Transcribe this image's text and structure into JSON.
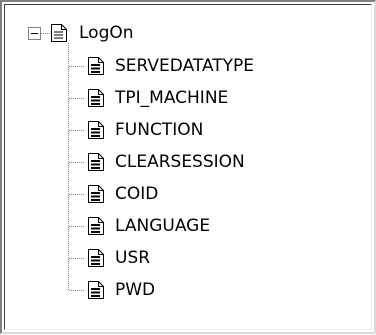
{
  "tree": {
    "root": {
      "label": "LogOn",
      "expanded": true,
      "expander_glyph": "minus-box",
      "icon": "document-icon"
    },
    "children": [
      {
        "label": "SERVEDATATYPE",
        "icon": "document-icon"
      },
      {
        "label": "TPI_MACHINE",
        "icon": "document-icon"
      },
      {
        "label": "FUNCTION",
        "icon": "document-icon"
      },
      {
        "label": "CLEARSESSION",
        "icon": "document-icon"
      },
      {
        "label": "COID",
        "icon": "document-icon"
      },
      {
        "label": "LANGUAGE",
        "icon": "document-icon"
      },
      {
        "label": "USR",
        "icon": "document-icon"
      },
      {
        "label": "PWD",
        "icon": "document-icon"
      }
    ]
  }
}
